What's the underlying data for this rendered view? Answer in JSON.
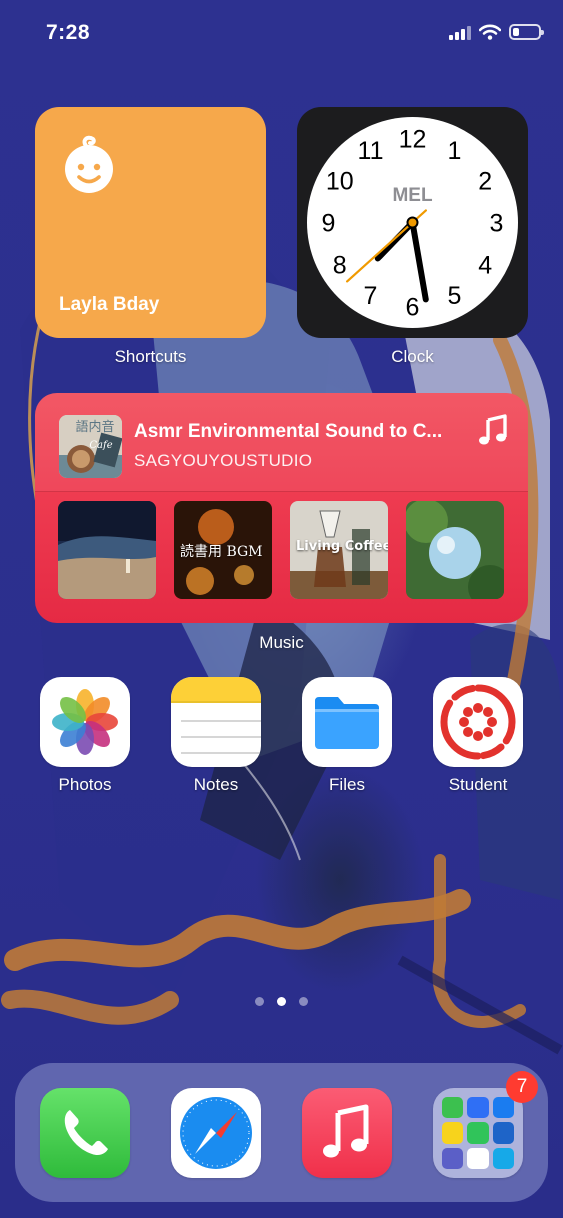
{
  "status_bar": {
    "time": "7:28",
    "battery_level": 0.25
  },
  "widgets": {
    "shortcuts": {
      "name": "Layla Bday",
      "label": "Shortcuts",
      "color": "#f6a84b"
    },
    "clock": {
      "city": "MEL",
      "label": "Clock",
      "numbers": [
        "12",
        "1",
        "2",
        "3",
        "4",
        "5",
        "6",
        "7",
        "8",
        "9",
        "10",
        "11"
      ],
      "time": {
        "hour": 7,
        "minute": 28,
        "second": 22
      }
    },
    "music": {
      "label": "Music",
      "now_playing": {
        "title": "Asmr Environmental Sound to C...",
        "artist": "SAGYOUYOUSTUDIO",
        "art_text": "語内音 Cafe"
      },
      "albums": [
        {
          "name": "beach-night"
        },
        {
          "name": "reading-bgm",
          "text": "読書用 BGM"
        },
        {
          "name": "living-coffee",
          "text": "Living Coffee"
        },
        {
          "name": "green-forest"
        }
      ],
      "accent": "#ee3b50"
    }
  },
  "apps": [
    {
      "name": "photos",
      "label": "Photos"
    },
    {
      "name": "notes",
      "label": "Notes"
    },
    {
      "name": "files",
      "label": "Files"
    },
    {
      "name": "student",
      "label": "Student"
    }
  ],
  "page_dots": {
    "count": 3,
    "active_index": 1
  },
  "dock": {
    "apps": [
      {
        "name": "phone",
        "icon": "phone-icon"
      },
      {
        "name": "safari",
        "icon": "compass-icon"
      },
      {
        "name": "music",
        "icon": "music-note-icon"
      },
      {
        "name": "folder",
        "icon": "app-folder-icon",
        "badge": "7"
      }
    ]
  }
}
